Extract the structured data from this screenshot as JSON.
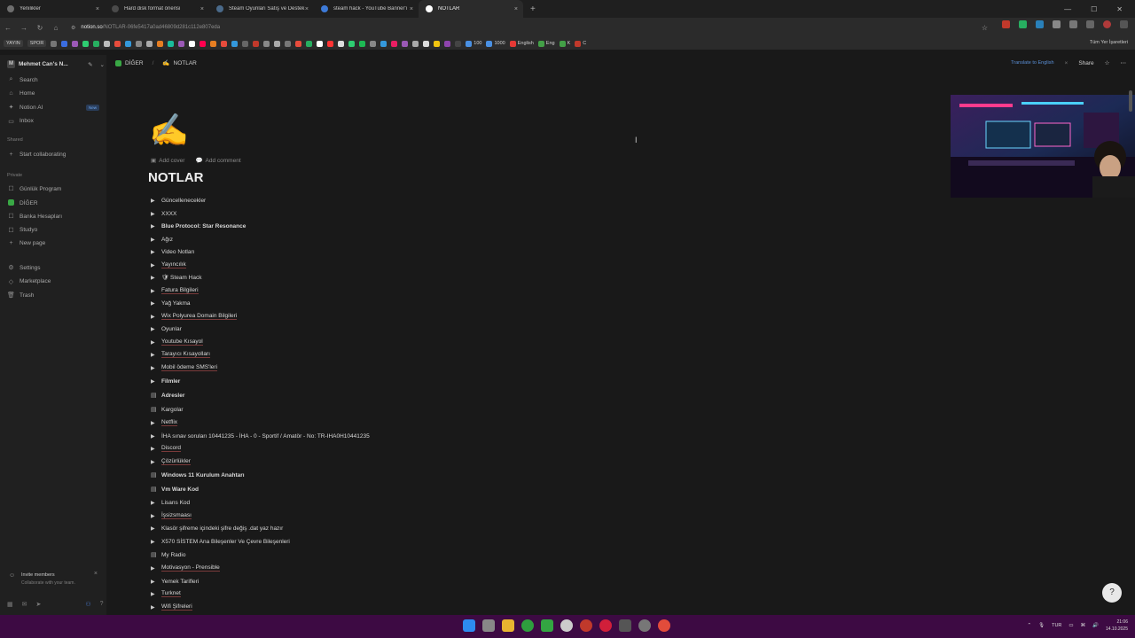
{
  "tabs": [
    {
      "label": "Yenilikler",
      "color": "#6e6e6e"
    },
    {
      "label": "Hard disk format önerisi",
      "color": "#4a4a4a"
    },
    {
      "label": "Steam Oyunları Satış ve Destek",
      "color": "#4a6a8a"
    },
    {
      "label": "steam hack - YouTube Banner'ı",
      "color": "#3d7ad8"
    },
    {
      "label": "NOTLAR",
      "color": "#ffffff",
      "active": true
    }
  ],
  "address": {
    "host": "notion.so",
    "path": "/NOTLAR-06fe5417a0ad46809d281c112e807eda"
  },
  "bookmarks": {
    "items": [
      "YAYIN",
      "SPOR"
    ],
    "labels": [
      "100",
      "1000",
      "English",
      "Eng",
      "K",
      "C"
    ],
    "right": "Tüm Yer İşaretleri"
  },
  "sidebar": {
    "workspace": "Mehmet Can's N...",
    "workspace_initial": "M",
    "nav": [
      {
        "label": "Search",
        "icon": "⌕"
      },
      {
        "label": "Home",
        "icon": "⌂"
      },
      {
        "label": "Notion AI",
        "icon": "✦",
        "badge": "New"
      },
      {
        "label": "Inbox",
        "icon": "▭"
      }
    ],
    "shared_header": "Shared",
    "shared_items": [
      {
        "label": "Start collaborating",
        "icon": "+"
      }
    ],
    "private_header": "Private",
    "private_items": [
      {
        "label": "Günlük Program",
        "icon": "☐"
      },
      {
        "label": "DİĞER",
        "icon": "■"
      },
      {
        "label": "Banka Hesapları",
        "icon": "☐"
      },
      {
        "label": "Studyo",
        "icon": "☐"
      },
      {
        "label": "New page",
        "icon": "+"
      }
    ],
    "bottom_items": [
      {
        "label": "Settings",
        "icon": "⚙"
      },
      {
        "label": "Marketplace",
        "icon": "◇"
      },
      {
        "label": "Trash",
        "icon": "🗑"
      }
    ],
    "invite_title": "Invite members",
    "invite_sub": "Collaborate with your team."
  },
  "topbar": {
    "crumb1": "DİĞER",
    "crumb2": "NOTLAR",
    "translate": "Translate to English",
    "share": "Share"
  },
  "page": {
    "icon": "✍",
    "add_cover": "Add cover",
    "add_comment": "Add comment",
    "title": "NOTLAR",
    "rows": [
      {
        "label": "Güncellenecekler",
        "kind": "toggle"
      },
      {
        "label": "XXXX",
        "kind": "toggle"
      },
      {
        "label": "Blue Protocol: Star Resonance",
        "kind": "toggle",
        "bold": true
      },
      {
        "label": "Ağız",
        "kind": "toggle"
      },
      {
        "label": "Video Notları",
        "kind": "toggle"
      },
      {
        "label": "Yayıncılık",
        "kind": "toggle",
        "ul": true
      },
      {
        "label": "🛡 Steam Hack",
        "kind": "toggle"
      },
      {
        "label": "Fatura Bilgileri",
        "kind": "toggle",
        "ul": true
      },
      {
        "label": "Yağ Yakma",
        "kind": "toggle"
      },
      {
        "label": "Wix Polyurea Domain Bilgileri",
        "kind": "toggle",
        "ul": true
      },
      {
        "label": "Oyunlar",
        "kind": "toggle"
      },
      {
        "label": "Youtube Kısayol",
        "kind": "toggle",
        "ul": true
      },
      {
        "label": "Tarayıcı Kısayolları",
        "kind": "toggle",
        "ul": true
      },
      {
        "label": "Mobil ödeme SMS'leri",
        "kind": "toggle",
        "ul": true
      },
      {
        "label": "Filmler",
        "kind": "toggle",
        "bold": true
      },
      {
        "label": "Adresler",
        "kind": "page",
        "bold": true
      },
      {
        "label": "Kargolar",
        "kind": "page"
      },
      {
        "label": "Netflix",
        "kind": "toggle",
        "ul": true
      },
      {
        "label": "İHA sınav soruları 10441235 - İHA - 0 - Sportif / Amatör - No: TR-IHA0H10441235",
        "kind": "toggle"
      },
      {
        "label": "Discord",
        "kind": "toggle",
        "ul": true
      },
      {
        "label": "Çözürlükler",
        "kind": "toggle",
        "ul": true
      },
      {
        "label": "Windows 11 Kurulum Anahtarı",
        "kind": "page",
        "bold": true
      },
      {
        "label": "Vm Ware Kod",
        "kind": "page",
        "bold": true
      },
      {
        "label": "Lisans Kod",
        "kind": "toggle"
      },
      {
        "label": "İşsizsmaası",
        "kind": "toggle",
        "ul": true
      },
      {
        "label": "Klasör şifreme içindeki şifre değiş .dat yaz hazır",
        "kind": "toggle"
      },
      {
        "label": "X570 SİSTEM Ana Bileşenler Ve Çevre Bileşenleri",
        "kind": "toggle"
      },
      {
        "label": "My Radio",
        "kind": "page"
      },
      {
        "label": "Motivasyon - Prensible",
        "kind": "toggle",
        "ul": true
      },
      {
        "label": "Yemek Tarifleri",
        "kind": "toggle"
      },
      {
        "label": "Turknet",
        "kind": "toggle",
        "ul": true
      },
      {
        "label": "Wifi Şifreleri",
        "kind": "toggle",
        "ul": true
      }
    ]
  },
  "tray": {
    "lang": "TUR",
    "time": "21:06",
    "date": "14.10.2025"
  }
}
